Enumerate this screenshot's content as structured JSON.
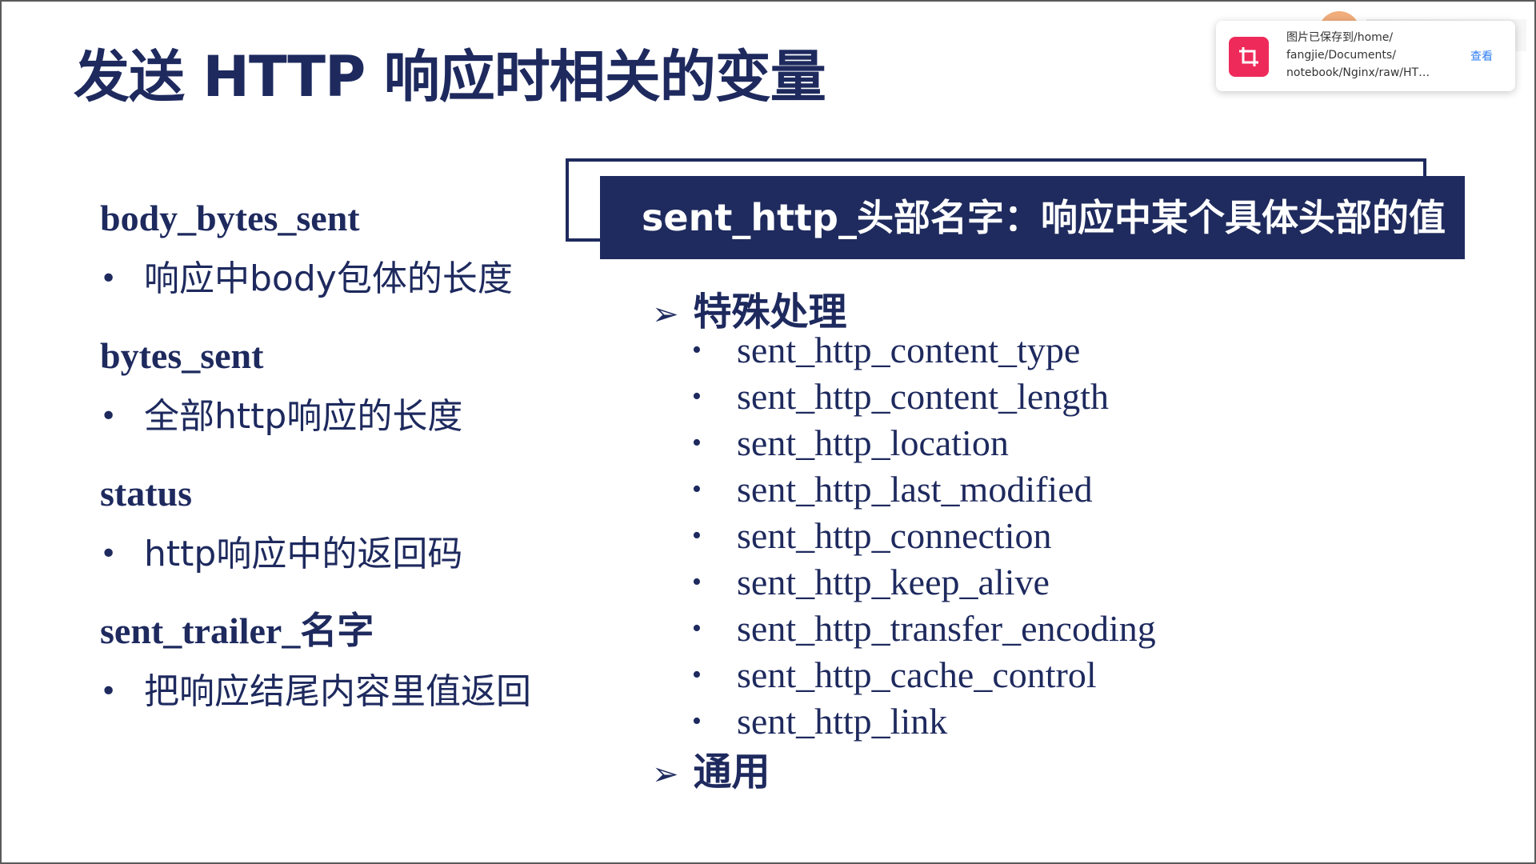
{
  "slide": {
    "title": "发送 HTTP 响应时相关的变量"
  },
  "left": {
    "entries": [
      {
        "term": "body_bytes_sent",
        "bullet": "•",
        "desc": "响应中body包体的长度"
      },
      {
        "term": "bytes_sent",
        "bullet": "•",
        "desc": "全部http响应的长度"
      },
      {
        "term": "status",
        "bullet": "•",
        "desc": "http响应中的返回码"
      },
      {
        "term": "sent_trailer_名字",
        "bullet": "•",
        "desc": "把响应结尾内容里值返回"
      }
    ]
  },
  "right": {
    "banner": "sent_http_头部名字：响应中某个具体头部的值",
    "arrow_glyph": "➢",
    "special_heading": "特殊处理",
    "special_items": [
      "sent_http_content_type",
      "sent_http_content_length",
      "sent_http_location",
      "sent_http_last_modified",
      "sent_http_connection",
      "sent_http_keep_alive",
      "sent_http_transfer_encoding",
      "sent_http_cache_control",
      "sent_http_link"
    ],
    "general_heading": "通用"
  },
  "toast": {
    "icon": "crop-icon",
    "line1": "图片已保存到/home/",
    "line2": "fangjie/Documents/",
    "line3": "notebook/Nginx/raw/HT…",
    "view_label": "查看"
  },
  "colors": {
    "navy": "#1e2a5e",
    "banner_bg": "#1f2b5e",
    "toast_icon_bg": "#ee2a5a",
    "link_blue": "#2f7ef0"
  }
}
